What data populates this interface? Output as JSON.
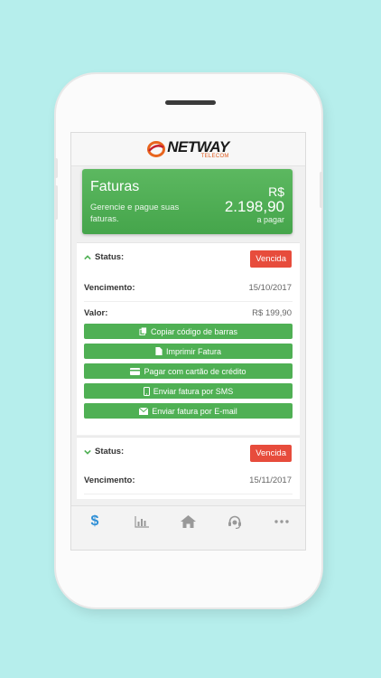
{
  "app": {
    "logo_main": "NETWAY",
    "logo_sub": "TELECOM"
  },
  "summary": {
    "title": "Faturas",
    "description": "Gerencie e pague suas faturas.",
    "currency": "R$",
    "amount": "2.198,90",
    "amount_caption": "a pagar"
  },
  "invoices": [
    {
      "status_label": "Status:",
      "status_badge": "Vencida",
      "due_label": "Vencimento:",
      "due_date": "15/10/2017",
      "value_label": "Valor:",
      "value": "R$ 199,90",
      "expanded": true
    },
    {
      "status_label": "Status:",
      "status_badge": "Vencida",
      "due_label": "Vencimento:",
      "due_date": "15/11/2017",
      "expanded": false
    }
  ],
  "actions": {
    "copy_barcode": "Copiar código de barras",
    "print": "Imprimir Fatura",
    "pay_card": "Pagar com cartão de crédito",
    "send_sms": "Enviar fatura por SMS",
    "send_email": "Enviar fatura por E-mail"
  },
  "tabs": [
    {
      "icon": "dollar-icon",
      "active": true
    },
    {
      "icon": "bar-chart-icon",
      "active": false
    },
    {
      "icon": "home-icon",
      "active": false
    },
    {
      "icon": "support-headset-icon",
      "active": false
    },
    {
      "icon": "more-icon",
      "active": false
    }
  ],
  "colors": {
    "background": "#b6eeec",
    "accent_green": "#4fb054",
    "badge_red": "#e74c3c",
    "active_tab": "#2f8fd6"
  }
}
